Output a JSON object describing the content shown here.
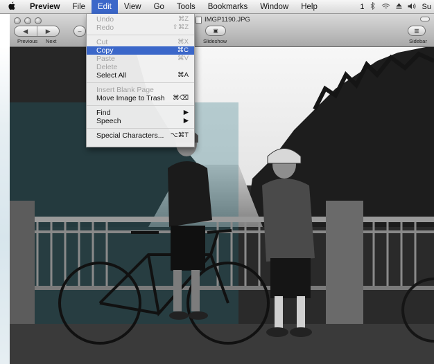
{
  "menubar": {
    "apple_glyph": "",
    "items": [
      "Preview",
      "File",
      "Edit",
      "View",
      "Go",
      "Tools",
      "Bookmarks",
      "Window",
      "Help"
    ],
    "status": {
      "display": "1",
      "text": "Su"
    }
  },
  "toolbar": {
    "previous_label": "Previous",
    "next_label": "Next",
    "slideshow_label": "Slideshow",
    "sidebar_label": "Sidebar",
    "document_title": "IMGP1190.JPG"
  },
  "edit_menu": {
    "items": [
      {
        "label": "Undo",
        "shortcut": "⌘Z",
        "enabled": false
      },
      {
        "label": "Redo",
        "shortcut": "⇧⌘Z",
        "enabled": false
      },
      {
        "label": "Cut",
        "shortcut": "⌘X",
        "enabled": false
      },
      {
        "label": "Copy",
        "shortcut": "⌘C",
        "enabled": true,
        "selected": true
      },
      {
        "label": "Paste",
        "shortcut": "⌘V",
        "enabled": false
      },
      {
        "label": "Delete",
        "shortcut": "",
        "enabled": false
      },
      {
        "label": "Select All",
        "shortcut": "⌘A",
        "enabled": true
      },
      {
        "label": "Insert Blank Page",
        "shortcut": "",
        "enabled": false
      },
      {
        "label": "Move Image to Trash",
        "shortcut": "⌘⌫",
        "enabled": true
      },
      {
        "label": "Find",
        "shortcut": "▶",
        "enabled": true
      },
      {
        "label": "Speech",
        "shortcut": "▶",
        "enabled": true
      },
      {
        "label": "Special Characters...",
        "shortcut": "⌥⌘T",
        "enabled": true
      }
    ]
  },
  "colors": {
    "menu_highlight": "#3b67c9",
    "tint": "#1f6f7e"
  }
}
